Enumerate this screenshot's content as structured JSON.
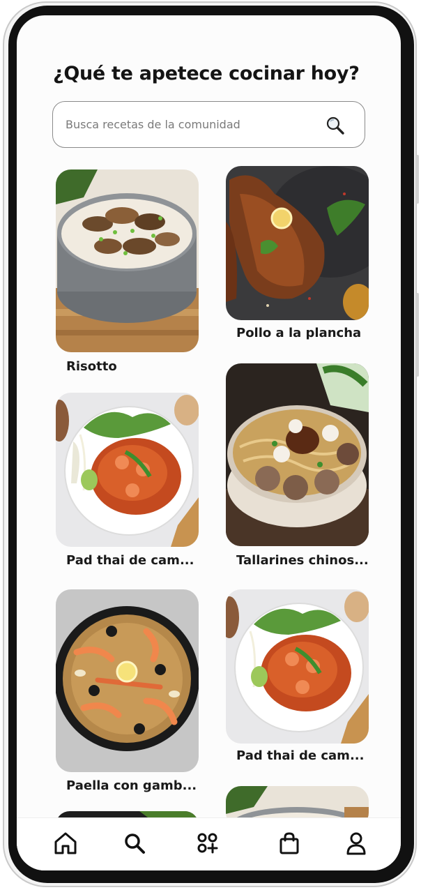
{
  "header": {
    "title": "¿Qué te apetece cocinar hoy?"
  },
  "search": {
    "placeholder": "Busca recetas de la comunidad",
    "icon": "magnifier-icon"
  },
  "recipes": [
    {
      "title": "Risotto",
      "image": "risotto-mushroom-bowl"
    },
    {
      "title": "Pollo a la plancha",
      "image": "grilled-chicken-leg"
    },
    {
      "title": "Pad thai de cam...",
      "image": "pad-thai-shrimp-plate"
    },
    {
      "title": "Tallarines chinos...",
      "image": "noodle-meatball-bowl"
    },
    {
      "title": "Paella con gamb...",
      "image": "seafood-paella-pan"
    },
    {
      "title": "Pad thai de cam...",
      "image": "pad-thai-shrimp-plate"
    }
  ],
  "nav": {
    "items": [
      {
        "name": "home",
        "icon": "home-icon"
      },
      {
        "name": "search",
        "icon": "search-icon"
      },
      {
        "name": "add",
        "icon": "grid-plus-icon"
      },
      {
        "name": "cart",
        "icon": "shopping-bag-icon"
      },
      {
        "name": "profile",
        "icon": "user-icon"
      }
    ]
  },
  "colors": {
    "background": "#fcfcfc",
    "text": "#141414",
    "search_border": "#8a8a8a"
  }
}
